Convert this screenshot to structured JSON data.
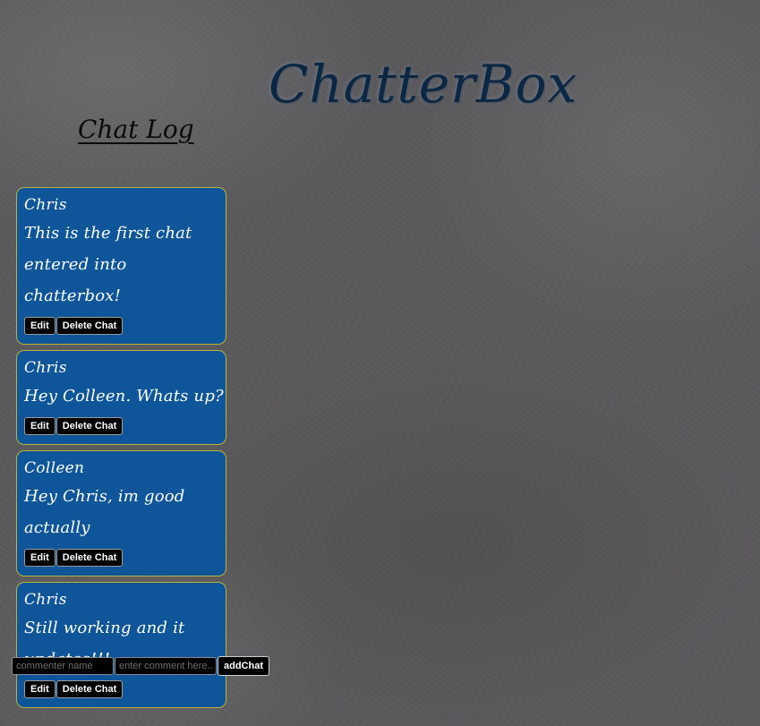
{
  "app": {
    "title": "ChatterBox"
  },
  "chat_log": {
    "title": "Chat Log",
    "chats": [
      {
        "author": "Chris",
        "message": "This is the first chat entered into chatterbox!",
        "edit_label": "Edit",
        "delete_label": "Delete Chat"
      },
      {
        "author": "Chris",
        "message": "Hey Colleen. Whats up?",
        "edit_label": "Edit",
        "delete_label": "Delete Chat"
      },
      {
        "author": "Colleen",
        "message": "Hey Chris, im good actually",
        "edit_label": "Edit",
        "delete_label": "Delete Chat"
      },
      {
        "author": "Chris",
        "message": "Still working and it updates!!!",
        "edit_label": "Edit",
        "delete_label": "Delete Chat"
      }
    ]
  },
  "composer": {
    "name_value": "",
    "name_placeholder": "commenter name",
    "comment_value": "",
    "comment_placeholder": "enter comment here...",
    "add_label": "addChat"
  },
  "colors": {
    "card_background": "#0e5699",
    "card_border": "#b9b33c",
    "title_color": "#0b2744",
    "button_background": "#000000",
    "chalkboard": "#5a595c"
  }
}
